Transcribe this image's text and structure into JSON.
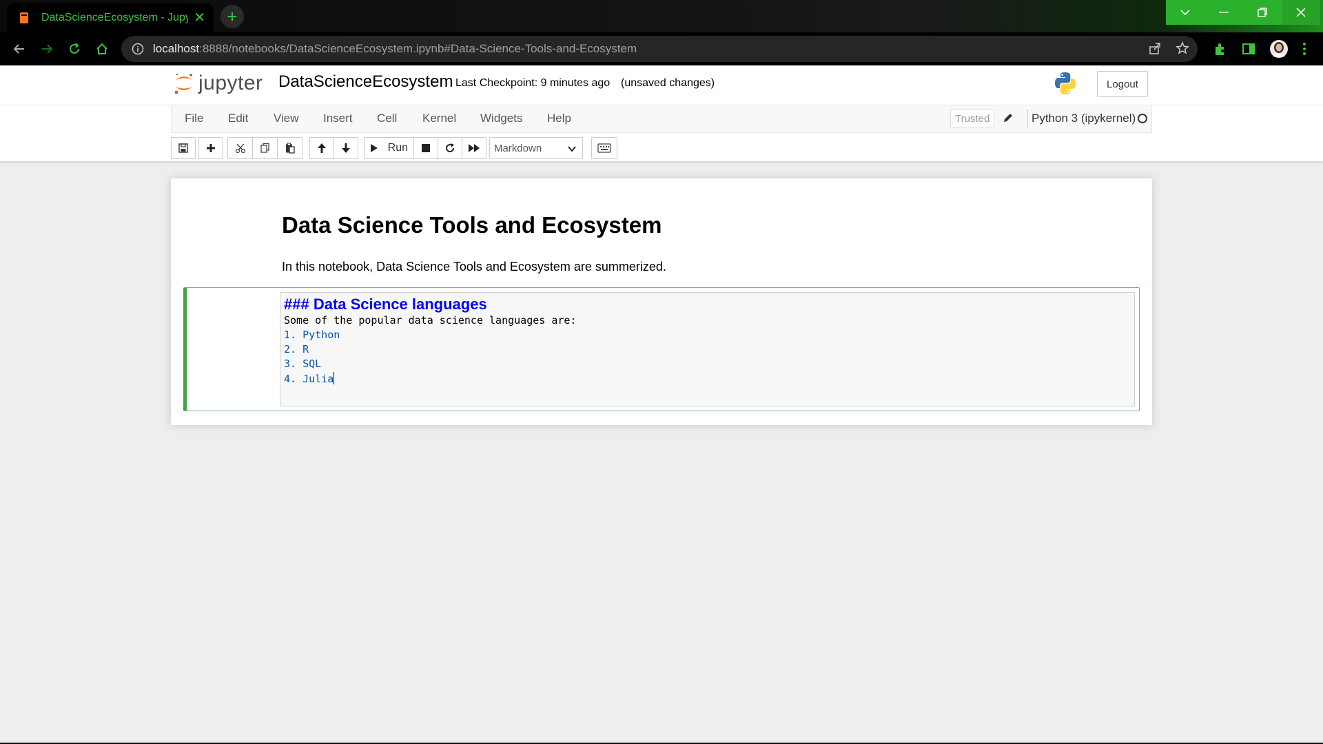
{
  "browser": {
    "tab_title": "DataScienceEcosystem - Jupyter",
    "url_host": "localhost",
    "url_rest": ":8888/notebooks/DataScienceEcosystem.ipynb#Data-Science-Tools-and-Ecosystem",
    "accent_color": "#3ec43e"
  },
  "header": {
    "logo_text": "jupyter",
    "notebook_name": "DataScienceEcosystem",
    "checkpoint": "Last Checkpoint: 9 minutes ago",
    "save_status": "(unsaved changes)",
    "logout_label": "Logout"
  },
  "menu": {
    "items": [
      "File",
      "Edit",
      "View",
      "Insert",
      "Cell",
      "Kernel",
      "Widgets",
      "Help"
    ],
    "trusted_label": "Trusted",
    "kernel_name": "Python 3 (ipykernel)"
  },
  "toolbar": {
    "run_label": "Run",
    "cell_type": "Markdown",
    "icons": [
      "save-icon",
      "plus-icon",
      "cut-icon",
      "copy-icon",
      "paste-icon",
      "arrow-up-icon",
      "arrow-down-icon",
      "play-icon",
      "stop-icon",
      "restart-icon",
      "fast-forward-icon",
      "keyboard-icon"
    ]
  },
  "notebook": {
    "title": "Data Science Tools and Ecosystem",
    "intro": "In this notebook, Data Science Tools and Ecosystem are summerized.",
    "edit_cell": {
      "header": "### Data Science languages",
      "line1": "Some of the popular data science languages are:",
      "list": [
        {
          "num": "1.",
          "text": "Python"
        },
        {
          "num": "2.",
          "text": "R"
        },
        {
          "num": "3.",
          "text": "SQL"
        },
        {
          "num": "4.",
          "text": "Julia"
        }
      ]
    }
  }
}
